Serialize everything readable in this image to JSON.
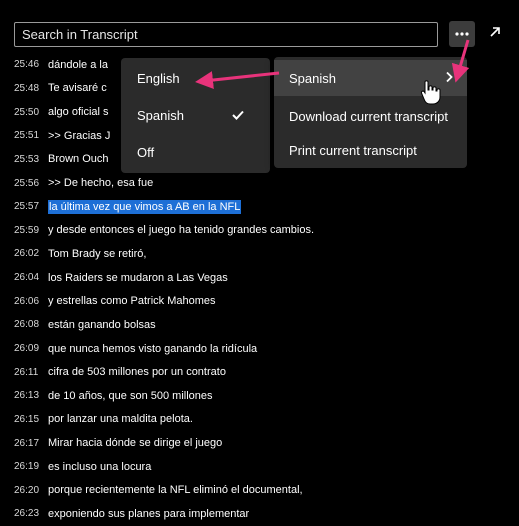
{
  "search": {
    "placeholder": "Search in Transcript"
  },
  "toolbar": {
    "more_icon": "more-horizontal-icon",
    "popout_icon": "arrow-up-right-icon"
  },
  "transcript": [
    {
      "time": "25:46",
      "text": "dándole a la"
    },
    {
      "time": "25:48",
      "text": "Te avisaré c"
    },
    {
      "time": "25:50",
      "text": "algo oficial s"
    },
    {
      "time": "25:51",
      "text": ">> Gracias J"
    },
    {
      "time": "25:53",
      "text": "Brown Ouch"
    },
    {
      "time": "25:56",
      "text": ">> De hecho, esa fue"
    },
    {
      "time": "25:57",
      "text": "la última vez que vimos a AB en la NFL",
      "highlighted": true
    },
    {
      "time": "25:59",
      "text": "y desde entonces el juego ha tenido grandes cambios."
    },
    {
      "time": "26:02",
      "text": "Tom Brady se retiró,"
    },
    {
      "time": "26:04",
      "text": "los Raiders se mudaron a Las Vegas"
    },
    {
      "time": "26:06",
      "text": "y estrellas como Patrick Mahomes"
    },
    {
      "time": "26:08",
      "text": "están ganando bolsas"
    },
    {
      "time": "26:09",
      "text": "que nunca hemos visto ganando la ridícula"
    },
    {
      "time": "26:11",
      "text": "cifra de 503 millones por un contrato"
    },
    {
      "time": "26:13",
      "text": "de 10 años, que son 500 millones"
    },
    {
      "time": "26:15",
      "text": "por lanzar una maldita pelota."
    },
    {
      "time": "26:17",
      "text": "Mirar hacia dónde se dirige el juego"
    },
    {
      "time": "26:19",
      "text": "es incluso una locura"
    },
    {
      "time": "26:20",
      "text": "porque recientemente la NFL eliminó el documental,"
    },
    {
      "time": "26:23",
      "text": "exponiendo sus planes para implementar"
    }
  ],
  "language_menu": {
    "items": [
      {
        "label": "English",
        "checked": false
      },
      {
        "label": "Spanish",
        "checked": true
      },
      {
        "label": "Off",
        "checked": false
      }
    ]
  },
  "options_menu": {
    "language_label": "Spanish",
    "download_label": "Download current transcript",
    "print_label": "Print current transcript"
  },
  "colors": {
    "highlight": "#1d6fd6",
    "arrow": "#e8337b",
    "menu_bg": "#2b2b2b"
  }
}
